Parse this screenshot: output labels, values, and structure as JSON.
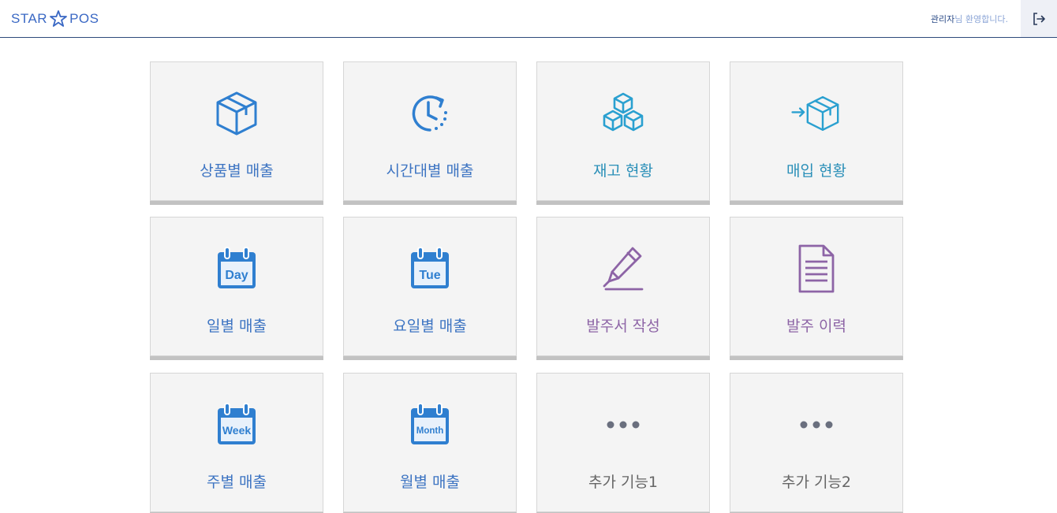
{
  "header": {
    "logo_left": "STAR",
    "logo_right": "POS",
    "user_name": "관리자",
    "greeting_suffix": "님 환영합니다."
  },
  "tiles": [
    {
      "label": "상품별 매출",
      "icon": "box-icon",
      "color": "#3d74c2"
    },
    {
      "label": "시간대별 매출",
      "icon": "clock-icon",
      "color": "#3d74c2"
    },
    {
      "label": "재고 현황",
      "icon": "stacked-boxes-icon",
      "color": "#2a8fb8"
    },
    {
      "label": "매입 현황",
      "icon": "incoming-box-icon",
      "color": "#2a8fb8"
    },
    {
      "label": "일별 매출",
      "icon": "calendar-day-icon",
      "icon_text": "Day",
      "color": "#3d74c2"
    },
    {
      "label": "요일별 매출",
      "icon": "calendar-weekday-icon",
      "icon_text": "Tue",
      "color": "#3d74c2"
    },
    {
      "label": "발주서 작성",
      "icon": "pen-icon",
      "color": "#8d64a6"
    },
    {
      "label": "발주 이력",
      "icon": "document-icon",
      "color": "#8d64a6"
    },
    {
      "label": "주별 매출",
      "icon": "calendar-week-icon",
      "icon_text": "Week",
      "color": "#3d74c2"
    },
    {
      "label": "월별 매출",
      "icon": "calendar-month-icon",
      "icon_text": "Month",
      "color": "#3d74c2"
    },
    {
      "label": "추가 기능1",
      "icon": "more-dots-icon",
      "color": "#666666"
    },
    {
      "label": "추가 기능2",
      "icon": "more-dots-icon",
      "color": "#666666"
    }
  ]
}
